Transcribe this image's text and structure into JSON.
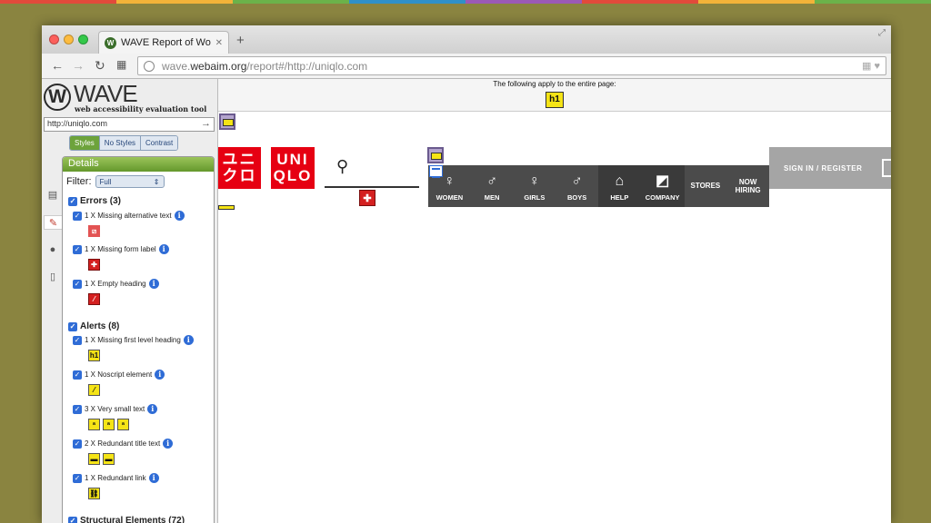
{
  "background_stripe_colors": [
    "#e24a3b",
    "#f2b339",
    "#6bb24a",
    "#2f90c8",
    "#9b59b6",
    "#e24a3b",
    "#f2b339",
    "#6bb24a"
  ],
  "browser": {
    "tab_title": "WAVE Report of Women's, M",
    "address_prefix": "wave.",
    "address_domain": "webaim.org",
    "address_path": "/report#/http://uniqlo.com"
  },
  "wave": {
    "logo_title": "WAVE",
    "logo_subtitle": "web accessibility evaluation tool",
    "url_value": "http://uniqlo.com",
    "style_buttons": [
      "Styles",
      "No Styles",
      "Contrast"
    ],
    "details_title": "Details",
    "filter_label": "Filter:",
    "filter_value": "Full",
    "errors_header": "Errors (3)",
    "errors": [
      {
        "label": "1 X Missing alternative text"
      },
      {
        "label": "1 X Missing form label"
      },
      {
        "label": "1 X Empty heading"
      }
    ],
    "alerts_header": "Alerts (8)",
    "alerts": [
      {
        "label": "1 X Missing first level heading"
      },
      {
        "label": "1 X Noscript element"
      },
      {
        "label": "3 X Very small text"
      },
      {
        "label": "2 X Redundant title text"
      },
      {
        "label": "1 X Redundant link"
      }
    ],
    "structural_header": "Structural Elements (72)"
  },
  "page": {
    "notice": "The following apply to the entire page:",
    "h1_badge": "h1",
    "logo_jp": "ユニ\nクロ",
    "logo_en": "UNI\nQLO",
    "nav": [
      "WOMEN",
      "MEN",
      "GIRLS",
      "BOYS",
      "HELP",
      "COMPANY",
      "STORES",
      "NOW\nHIRING"
    ],
    "signin": "SIGN IN / REGISTER",
    "brand_red": "#e60012"
  }
}
